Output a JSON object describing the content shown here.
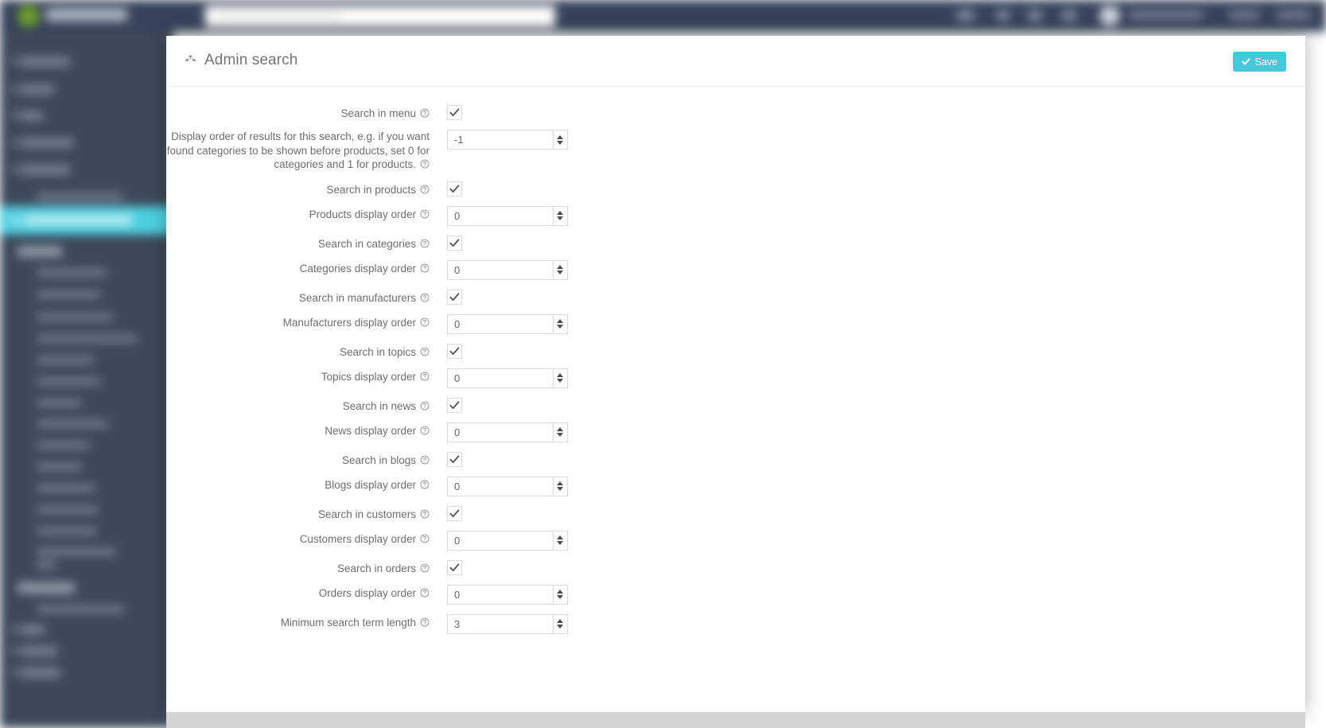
{
  "page": {
    "title": "Admin search",
    "title_icon": "cubes-icon"
  },
  "toolbar": {
    "save_label": "Save",
    "save_icon": "check-icon",
    "save_color": "#48c6da"
  },
  "topbar": {
    "search_placeholder": "",
    "background_color": "#37435a"
  },
  "sidebar": {
    "background_color": "#3d4859",
    "active_color": "#4ecfe0"
  },
  "form": {
    "rows": [
      {
        "label": "Search in menu",
        "type": "checkbox",
        "checked": true,
        "name": "search-in-menu"
      },
      {
        "label": "Display order of results for this search, e.g. if you want found categories to be shown before products, set 0 for categories and 1 for products.",
        "type": "number",
        "value": "-1",
        "name": "menu-display-order"
      },
      {
        "label": "Search in products",
        "type": "checkbox",
        "checked": true,
        "name": "search-in-products"
      },
      {
        "label": "Products display order",
        "type": "number",
        "value": "0",
        "name": "products-display-order"
      },
      {
        "label": "Search in categories",
        "type": "checkbox",
        "checked": true,
        "name": "search-in-categories"
      },
      {
        "label": "Categories display order",
        "type": "number",
        "value": "0",
        "name": "categories-display-order"
      },
      {
        "label": "Search in manufacturers",
        "type": "checkbox",
        "checked": true,
        "name": "search-in-manufacturers"
      },
      {
        "label": "Manufacturers display order",
        "type": "number",
        "value": "0",
        "name": "manufacturers-display-order"
      },
      {
        "label": "Search in topics",
        "type": "checkbox",
        "checked": true,
        "name": "search-in-topics"
      },
      {
        "label": "Topics display order",
        "type": "number",
        "value": "0",
        "name": "topics-display-order"
      },
      {
        "label": "Search in news",
        "type": "checkbox",
        "checked": true,
        "name": "search-in-news"
      },
      {
        "label": "News display order",
        "type": "number",
        "value": "0",
        "name": "news-display-order"
      },
      {
        "label": "Search in blogs",
        "type": "checkbox",
        "checked": true,
        "name": "search-in-blogs"
      },
      {
        "label": "Blogs display order",
        "type": "number",
        "value": "0",
        "name": "blogs-display-order"
      },
      {
        "label": "Search in customers",
        "type": "checkbox",
        "checked": true,
        "name": "search-in-customers"
      },
      {
        "label": "Customers display order",
        "type": "number",
        "value": "0",
        "name": "customers-display-order"
      },
      {
        "label": "Search in orders",
        "type": "checkbox",
        "checked": true,
        "name": "search-in-orders"
      },
      {
        "label": "Orders display order",
        "type": "number",
        "value": "0",
        "name": "orders-display-order"
      },
      {
        "label": "Minimum search term length",
        "type": "number",
        "value": "3",
        "name": "minimum-search-term-length"
      }
    ],
    "help_icon": "question-circle-icon"
  }
}
